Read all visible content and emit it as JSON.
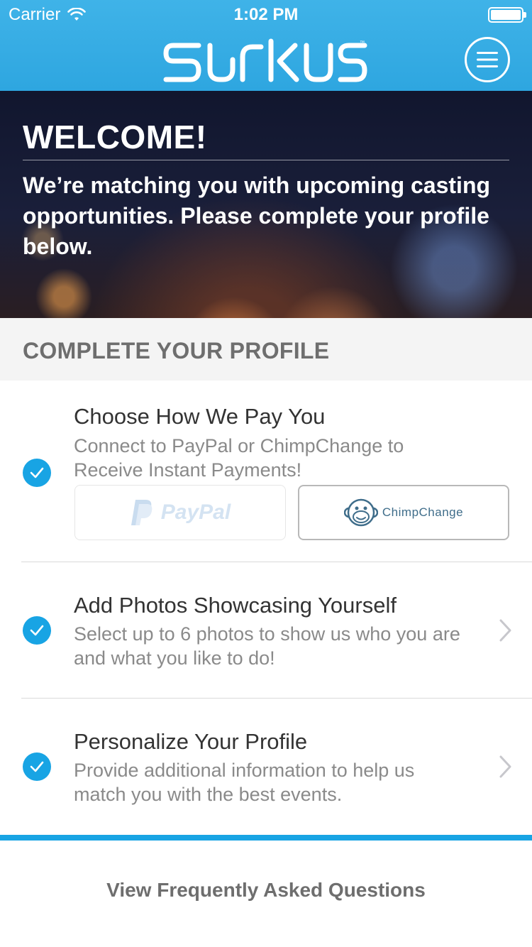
{
  "status_bar": {
    "carrier": "Carrier",
    "time": "1:02 PM"
  },
  "header": {
    "logo_text": "surkus",
    "logo_trademark": "™",
    "menu_icon": "hamburger-menu-icon"
  },
  "hero": {
    "title": "WELCOME!",
    "message": "We’re matching you with upcoming casting opportunities. Please complete your profile below."
  },
  "section": {
    "title": "COMPLETE YOUR PROFILE"
  },
  "items": [
    {
      "title": "Choose How We Pay You",
      "description": "Connect to PayPal or ChimpChange to Receive Instant Payments!",
      "checked": true
    },
    {
      "title": "Add Photos Showcasing Yourself",
      "description": "Select up to 6 photos to show us who you are and what you like to do!",
      "checked": true
    },
    {
      "title": "Personalize Your Profile",
      "description": "Provide additional information to help us match you with the best events.",
      "checked": true
    }
  ],
  "payment_options": {
    "paypal": "PayPal",
    "chimpchange": "ChimpChange"
  },
  "footer": {
    "faq_link": "View Frequently Asked Questions"
  },
  "colors": {
    "accent": "#18a4e4",
    "header": "#36abe4",
    "section_bg": "#f4f4f4"
  }
}
